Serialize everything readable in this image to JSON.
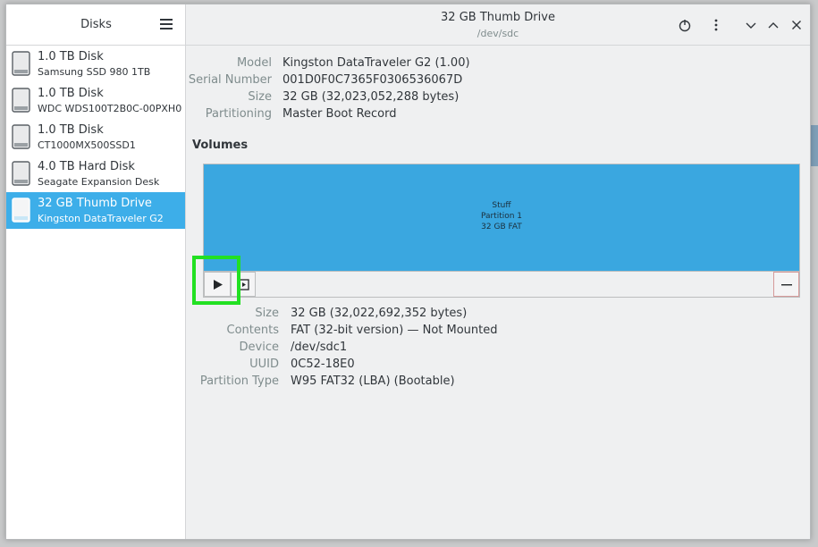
{
  "sidebar": {
    "title": "Disks",
    "menu_icon": "hamburger-menu-icon",
    "disks": [
      {
        "name": "1.0 TB Disk",
        "model": "Samsung SSD 980 1TB",
        "icon": "disk-drive-icon"
      },
      {
        "name": "1.0 TB Disk",
        "model": "WDC WDS100T2B0C-00PXH0",
        "icon": "disk-drive-icon"
      },
      {
        "name": "1.0 TB Disk",
        "model": "CT1000MX500SSD1",
        "icon": "disk-drive-icon"
      },
      {
        "name": "4.0 TB Hard Disk",
        "model": "Seagate Expansion Desk",
        "icon": "disk-drive-icon"
      },
      {
        "name": "32 GB Thumb Drive",
        "model": "Kingston DataTraveler G2",
        "icon": "disk-drive-icon",
        "selected": true
      }
    ]
  },
  "header": {
    "title": "32 GB Thumb Drive",
    "subtitle": "/dev/sdc",
    "icons": [
      "power-icon",
      "kebab-menu-icon",
      "minimize-icon",
      "maximize-icon",
      "close-icon"
    ]
  },
  "drive_info": {
    "model_label": "Model",
    "model": "Kingston DataTraveler G2 (1.00)",
    "serial_label": "Serial Number",
    "serial": "001D0F0C7365F0306536067D",
    "size_label": "Size",
    "size": "32 GB (32,023,052,288 bytes)",
    "partitioning_label": "Partitioning",
    "partitioning": "Master Boot Record"
  },
  "volumes": {
    "title": "Volumes",
    "partition": {
      "name": "Stuff",
      "number": "Partition 1",
      "desc": "32 GB FAT"
    },
    "color": "#3aa7e0"
  },
  "partition_info": {
    "size_label": "Size",
    "size": "32 GB (32,022,692,352 bytes)",
    "contents_label": "Contents",
    "contents": "FAT (32-bit version) — Not Mounted",
    "device_label": "Device",
    "device": "/dev/sdc1",
    "uuid_label": "UUID",
    "uuid": "0C52-18E0",
    "type_label": "Partition Type",
    "type": "W95 FAT32 (LBA) (Bootable)"
  },
  "highlight_color": "#22e022",
  "accent_color": "#3daee9"
}
